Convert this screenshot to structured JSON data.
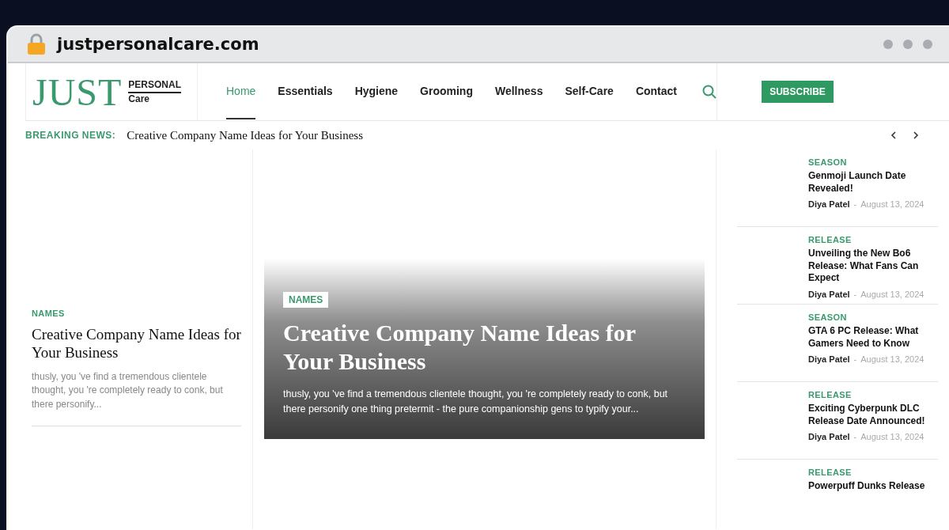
{
  "browser": {
    "url": "justpersonalcare.com"
  },
  "logo": {
    "main": "JUST",
    "top": "PERSONAL",
    "bottom": "Care"
  },
  "nav": [
    {
      "label": "Home",
      "selected": true
    },
    {
      "label": "Essentials",
      "selected": false
    },
    {
      "label": "Hygiene",
      "selected": false
    },
    {
      "label": "Grooming",
      "selected": false
    },
    {
      "label": "Wellness",
      "selected": false
    },
    {
      "label": "Self-Care",
      "selected": false
    },
    {
      "label": "Contact",
      "selected": false
    }
  ],
  "subscribe": "SUBSCRIBE",
  "breaking": {
    "label": "BREAKING NEWS:",
    "headline": "Creative Company Name Ideas for Your Business"
  },
  "left_article": {
    "category": "NAMES",
    "title": "Creative Company Name Ideas for Your Business",
    "excerpt": "thusly, you 've find a tremendous clientele thought, you 're completely ready to conk, but there personify..."
  },
  "featured": {
    "category": "NAMES",
    "title": "Creative Company Name Ideas for Your Business",
    "excerpt": "thusly, you 've find a tremendous clientele thought, you 're completely ready to conk, but there personify one thing pretermit - the pure companionship gens to typify your..."
  },
  "sidebar_articles": [
    {
      "category": "SEASON",
      "title": "Genmoji Launch Date Revealed!",
      "author": "Diya Patel",
      "separator": "-",
      "date": "August 13, 2024"
    },
    {
      "category": "RELEASE",
      "title": "Unveiling the New Bo6 Release: What Fans Can Expect",
      "author": "Diya Patel",
      "separator": "-",
      "date": "August 13, 2024"
    },
    {
      "category": "SEASON",
      "title": "GTA 6 PC Release: What Gamers Need to Know",
      "author": "Diya Patel",
      "separator": "-",
      "date": "August 13, 2024"
    },
    {
      "category": "RELEASE",
      "title": "Exciting Cyberpunk DLC Release Date Announced!",
      "author": "Diya Patel",
      "separator": "-",
      "date": "August 13, 2024"
    },
    {
      "category": "RELEASE",
      "title": "Powerpuff Dunks Release"
    }
  ]
}
